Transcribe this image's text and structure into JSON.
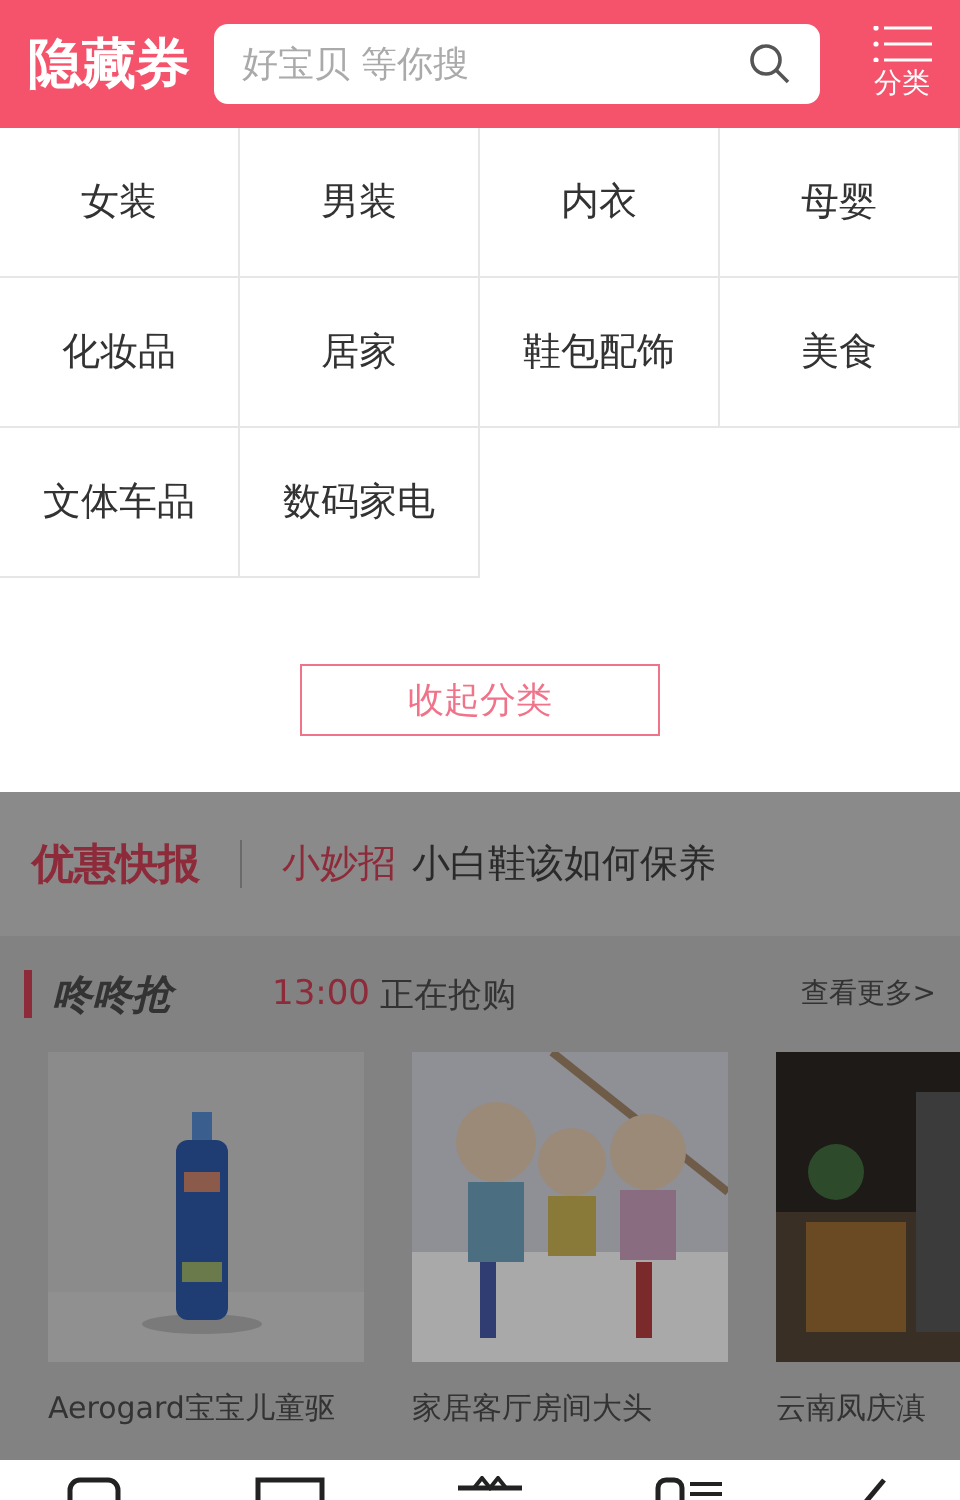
{
  "header": {
    "logo": "隐藏券",
    "search": {
      "placeholder": "好宝贝 等你搜"
    },
    "category_button": "分类"
  },
  "categories": [
    "女装",
    "男装",
    "内衣",
    "母婴",
    "化妆品",
    "居家",
    "鞋包配饰",
    "美食",
    "文体车品",
    "数码家电"
  ],
  "collapse_button": "收起分类",
  "news": {
    "title": "优惠快报",
    "tag": "小妙招",
    "headline": "小白鞋该如何保养"
  },
  "flash_sale": {
    "title": "咚咚抢",
    "time": "13:00",
    "status": "正在抢购",
    "more": "查看更多>"
  },
  "products": [
    {
      "name": "Aerogard宝宝儿童驱",
      "kind": "picture"
    },
    {
      "name": "家居客厅房间大头",
      "kind": "picture"
    },
    {
      "name": "云南凤庆滇",
      "kind": "picture"
    }
  ]
}
